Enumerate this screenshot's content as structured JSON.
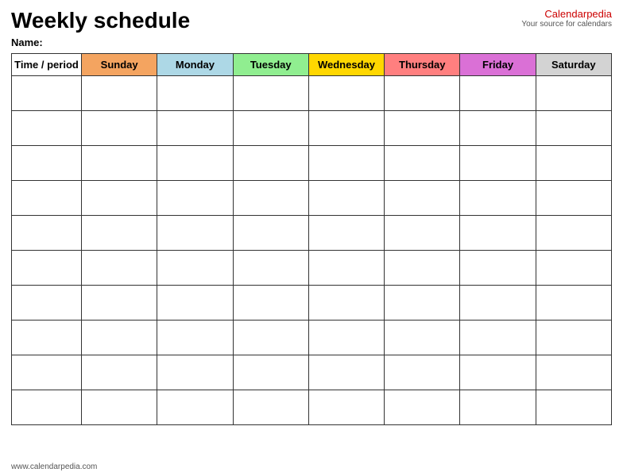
{
  "title": "Weekly schedule",
  "brand": {
    "name_part1": "Calendar",
    "name_part2": "pedia",
    "tagline": "Your source for calendars"
  },
  "name_label": "Name:",
  "columns": {
    "time": "Time / period",
    "sunday": "Sunday",
    "monday": "Monday",
    "tuesday": "Tuesday",
    "wednesday": "Wednesday",
    "thursday": "Thursday",
    "friday": "Friday",
    "saturday": "Saturday"
  },
  "rows": 10,
  "footer": "www.calendarpedia.com"
}
